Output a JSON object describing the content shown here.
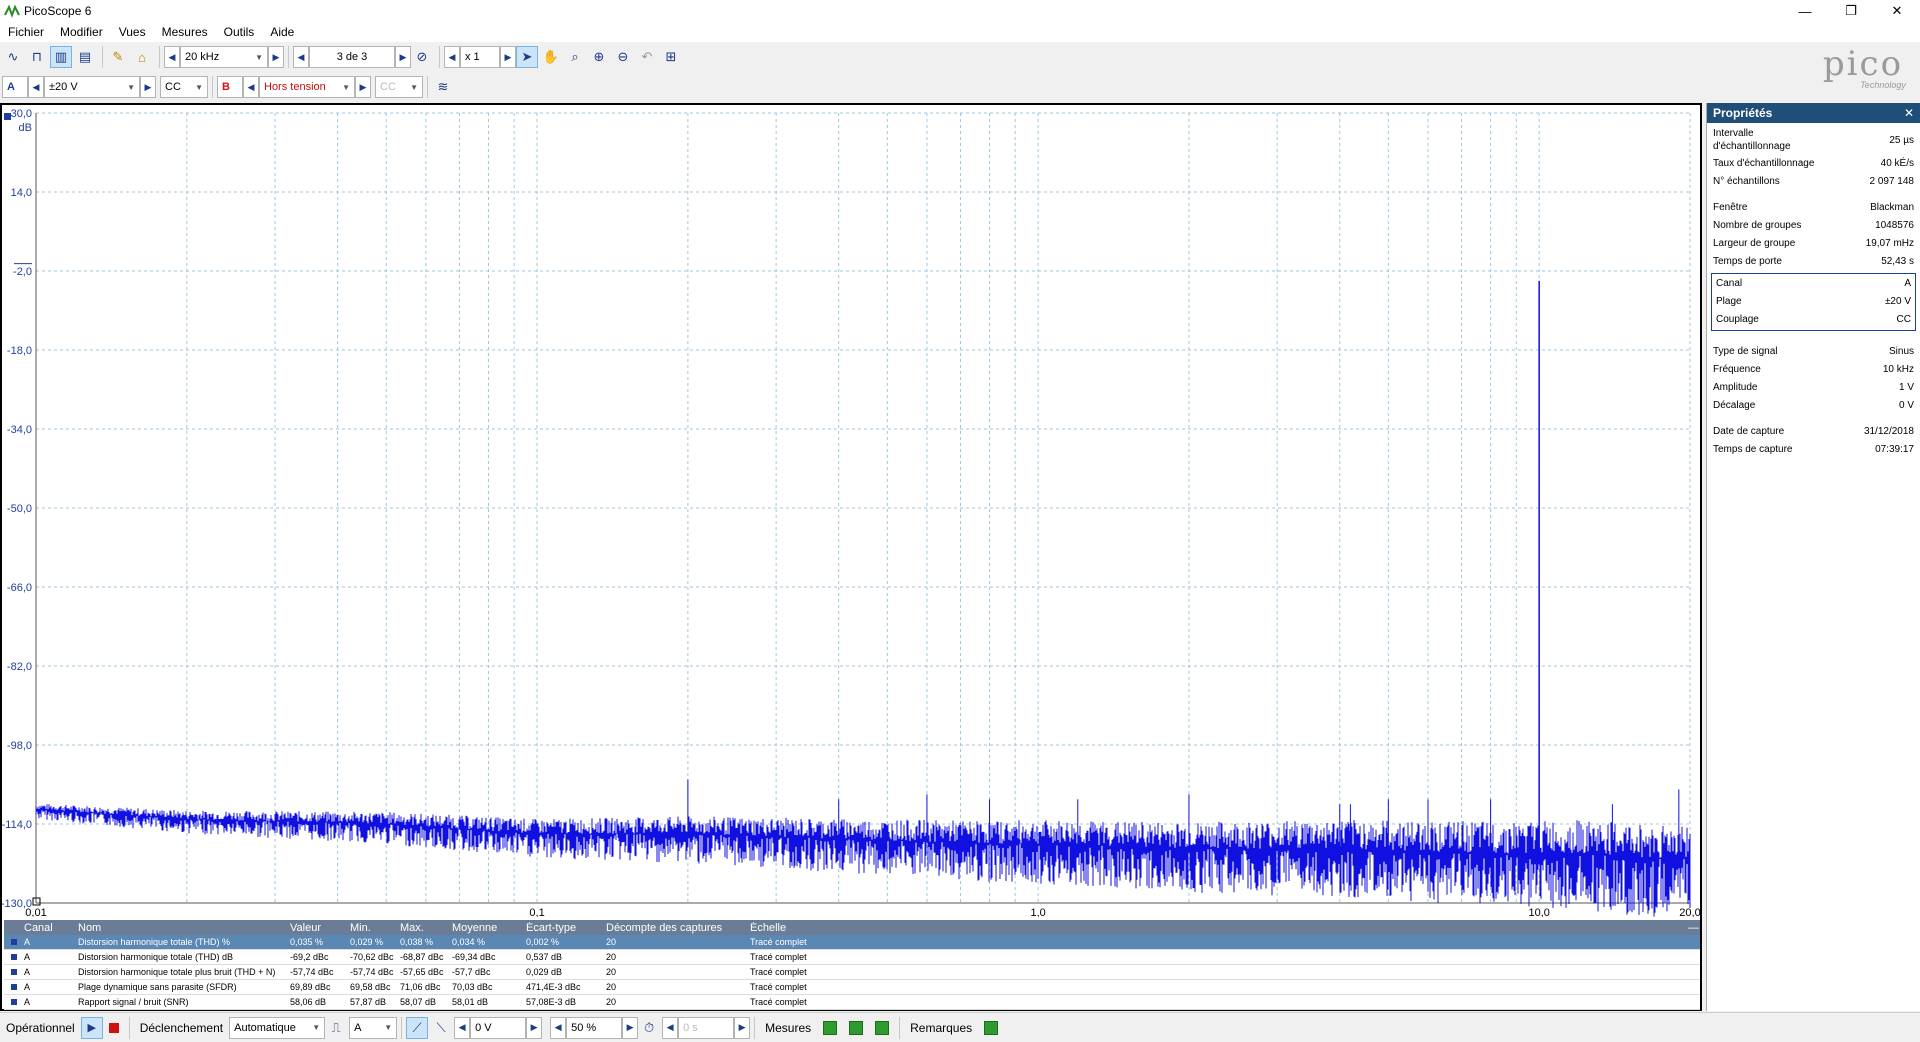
{
  "window": {
    "title": "PicoScope 6",
    "minimize": "—",
    "restore": "❐",
    "close": "✕"
  },
  "menu": [
    "Fichier",
    "Modifier",
    "Vues",
    "Mesures",
    "Outils",
    "Aide"
  ],
  "toolbar1": {
    "timebase": "20 kHz",
    "capture_index": "3 de 3",
    "zoom": "x 1"
  },
  "toolbar2": {
    "channel_a": "A",
    "range_a": "±20 V",
    "coupling_a": "CC",
    "channel_b": "B",
    "range_b": "Hors tension",
    "coupling_b": "CC"
  },
  "logo": {
    "name": "pico",
    "tagline": "Technology"
  },
  "plot": {
    "y_unit": "dB",
    "x_unit": "kHz",
    "x_scale_label": "x1.0",
    "y_ticks": [
      "30,0",
      "14,0",
      "-2,0",
      "-18,0",
      "-34,0",
      "-50,0",
      "-66,0",
      "-82,0",
      "-98,0",
      "-114,0",
      "-130,0"
    ],
    "x_ticks": [
      "0,01",
      "0,1",
      "1,0",
      "10,0",
      "20,0"
    ],
    "trace_color": "#1010e0"
  },
  "chart_data": {
    "type": "line",
    "title": "",
    "xlabel": "kHz",
    "ylabel": "dB",
    "xscale": "log",
    "xlim": [
      0.01,
      20.0
    ],
    "ylim": [
      -130,
      30
    ],
    "grid": true,
    "series": [
      {
        "x": [
          0.01,
          0.02,
          0.05,
          0.1,
          0.2,
          0.4,
          0.8,
          1.0,
          2.0,
          4.0,
          8.0,
          10.0,
          12.0,
          16.0,
          19.0,
          20.0
        ],
        "y": [
          -111,
          -113,
          -114,
          -116,
          -116,
          -117,
          -118,
          -118,
          -119,
          -119,
          -120,
          -4,
          -120,
          -121,
          -107,
          -121
        ]
      }
    ]
  },
  "properties": {
    "title": "Propriétés",
    "close": "✕",
    "group1": [
      {
        "k": "Intervalle d'échantillonnage",
        "v": "25 µs"
      },
      {
        "k": "Taux d'échantillonnage",
        "v": "40 kÉ/s"
      },
      {
        "k": "N° échantillons",
        "v": "2 097 148"
      }
    ],
    "group2": [
      {
        "k": "Fenêtre",
        "v": "Blackman"
      },
      {
        "k": "Nombre de groupes",
        "v": "1048576"
      },
      {
        "k": "Largeur de groupe",
        "v": "19,07 mHz"
      },
      {
        "k": "Temps de porte",
        "v": "52,43 s"
      }
    ],
    "group3": [
      {
        "k": "Canal",
        "v": "A"
      },
      {
        "k": "Plage",
        "v": "±20 V"
      },
      {
        "k": "Couplage",
        "v": "CC"
      }
    ],
    "group4": [
      {
        "k": "Type de signal",
        "v": "Sinus"
      },
      {
        "k": "Fréquence",
        "v": "10 kHz"
      },
      {
        "k": "Amplitude",
        "v": "1 V"
      },
      {
        "k": "Décalage",
        "v": "0 V"
      }
    ],
    "group5": [
      {
        "k": "Date de capture",
        "v": "31/12/2018"
      },
      {
        "k": "Temps de capture",
        "v": "07:39:17"
      }
    ]
  },
  "measurements": {
    "headers": [
      "Canal",
      "Nom",
      "Valeur",
      "Min.",
      "Max.",
      "Moyenne",
      "Écart-type",
      "Décompte des captures",
      "Échelle"
    ],
    "rows": [
      [
        "A",
        "Distorsion harmonique totale (THD) %",
        "0,035 %",
        "0,029 %",
        "0,038 %",
        "0,034 %",
        "0,002 %",
        "20",
        "Tracé complet"
      ],
      [
        "A",
        "Distorsion harmonique totale (THD) dB",
        "-69,2 dBc",
        "-70,62 dBc",
        "-68,87 dBc",
        "-69,34 dBc",
        "0,537 dB",
        "20",
        "Tracé complet"
      ],
      [
        "A",
        "Distorsion harmonique totale plus bruit (THD + N)",
        "-57,74 dBc",
        "-57,74 dBc",
        "-57,65 dBc",
        "-57,7 dBc",
        "0,029 dB",
        "20",
        "Tracé complet"
      ],
      [
        "A",
        "Plage dynamique sans parasite (SFDR)",
        "69,89 dBc",
        "69,58 dBc",
        "71,06 dBc",
        "70,03 dBc",
        "471,4E-3 dBc",
        "20",
        "Tracé complet"
      ],
      [
        "A",
        "Rapport signal / bruit (SNR)",
        "58,06 dB",
        "57,87 dB",
        "58,07 dB",
        "58,01 dB",
        "57,08E-3 dB",
        "20",
        "Tracé complet"
      ]
    ],
    "collapse": "—"
  },
  "status": {
    "operational": "Opérationnel",
    "trigger": "Déclenchement",
    "trigger_mode": "Automatique",
    "trigger_channel": "A",
    "threshold": "0 V",
    "pre_trigger": "50 %",
    "delay": "0 s",
    "measures": "Mesures",
    "notes": "Remarques"
  }
}
